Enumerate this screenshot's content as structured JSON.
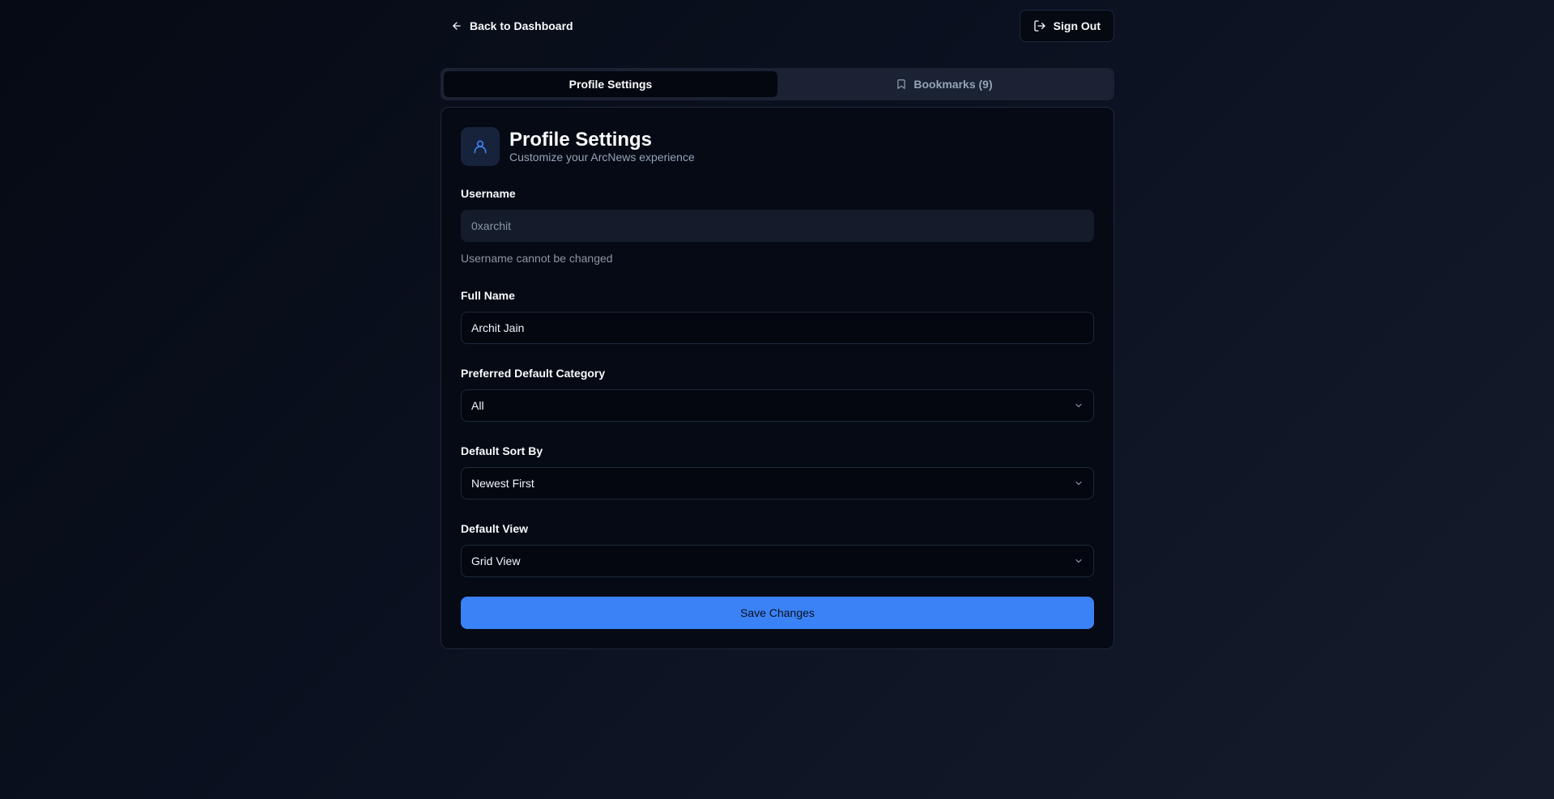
{
  "topbar": {
    "back_label": "Back to Dashboard",
    "signout_label": "Sign Out",
    "back_icon": "arrow-left-icon",
    "signout_icon": "log-out-icon"
  },
  "tabs": [
    {
      "label": "Profile Settings",
      "active": true
    },
    {
      "label": "Bookmarks (9)",
      "active": false,
      "icon": "bookmark-icon"
    }
  ],
  "card": {
    "title": "Profile Settings",
    "subtitle": "Customize your ArcNews experience",
    "icon": "user-icon"
  },
  "form": {
    "username": {
      "label": "Username",
      "value": "0xarchit",
      "hint": "Username cannot be changed"
    },
    "full_name": {
      "label": "Full Name",
      "value": "Archit Jain"
    },
    "category": {
      "label": "Preferred Default Category",
      "value": "All"
    },
    "sort": {
      "label": "Default Sort By",
      "value": "Newest First"
    },
    "view": {
      "label": "Default View",
      "value": "Grid View"
    },
    "save_label": "Save Changes"
  },
  "colors": {
    "accent": "#3b82f6",
    "background": "#0b1120",
    "card": "#060a14",
    "muted_text": "#94a3b8"
  }
}
